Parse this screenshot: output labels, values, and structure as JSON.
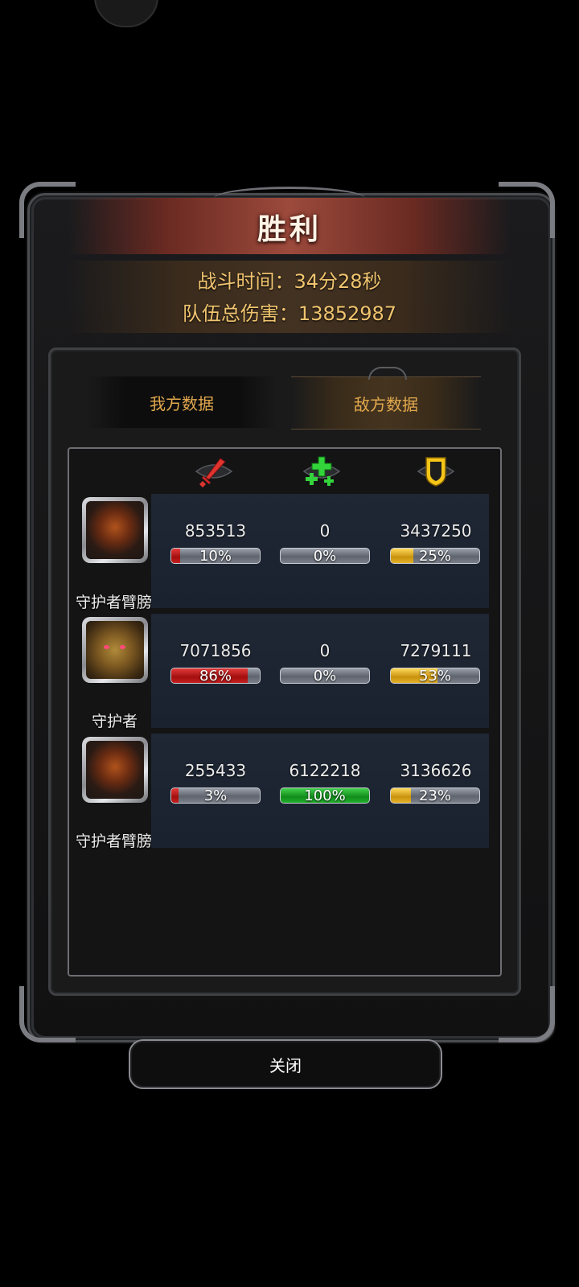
{
  "header": {
    "title": "胜利"
  },
  "battle_stats": {
    "time": "战斗时间：34分28秒",
    "damage_total": "队伍总伤害：13852987"
  },
  "tabs": [
    {
      "label": "我方数据",
      "active": false
    },
    {
      "label": "敌方数据",
      "active": true
    }
  ],
  "columns": [
    {
      "icon": "sword-icon",
      "color": "#e0342e"
    },
    {
      "icon": "heal-plus-icon",
      "color": "#33d43b"
    },
    {
      "icon": "shield-icon",
      "color": "#f5c518"
    }
  ],
  "rows": [
    {
      "name": "守护者臂膀",
      "portrait": "hooded-figure-icon",
      "damage": {
        "value": "853513",
        "pct": "10%",
        "ratio": 0.1
      },
      "heal": {
        "value": "0",
        "pct": "0%",
        "ratio": 0.0
      },
      "tank": {
        "value": "3437250",
        "pct": "25%",
        "ratio": 0.25
      }
    },
    {
      "name": "守护者",
      "portrait": "dragon-icon",
      "damage": {
        "value": "7071856",
        "pct": "86%",
        "ratio": 0.86
      },
      "heal": {
        "value": "0",
        "pct": "0%",
        "ratio": 0.0
      },
      "tank": {
        "value": "7279111",
        "pct": "53%",
        "ratio": 0.53
      }
    },
    {
      "name": "守护者臂膀",
      "portrait": "hooded-figure-icon",
      "damage": {
        "value": "255433",
        "pct": "3%",
        "ratio": 0.03
      },
      "heal": {
        "value": "6122218",
        "pct": "100%",
        "ratio": 1.0
      },
      "tank": {
        "value": "3136626",
        "pct": "23%",
        "ratio": 0.23
      }
    }
  ],
  "footer": {
    "close_label": "关闭"
  }
}
